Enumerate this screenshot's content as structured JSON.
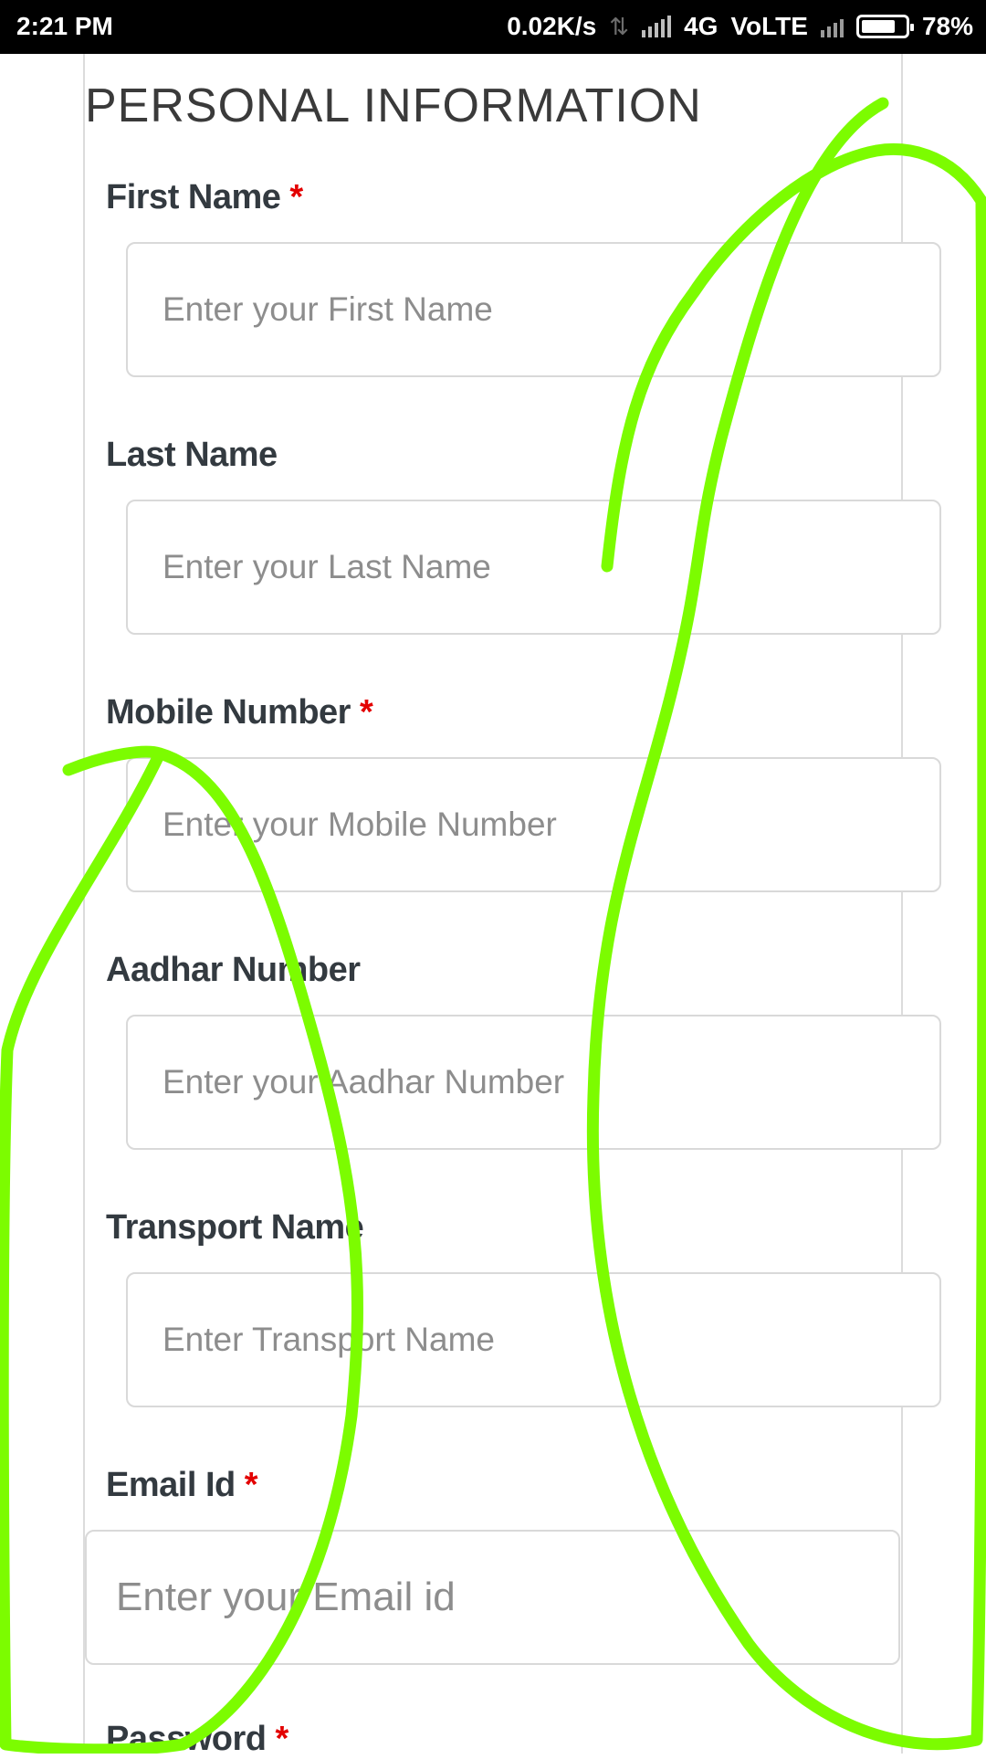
{
  "status_bar": {
    "time": "2:21 PM",
    "net_speed": "0.02K/s",
    "network": "4G",
    "volte": "VoLTE",
    "battery": "78%"
  },
  "form": {
    "section_title": "PERSONAL INFORMATION",
    "required_marker": "*",
    "fields": [
      {
        "label": "First Name",
        "placeholder": "Enter your First Name",
        "required": true
      },
      {
        "label": "Last Name",
        "placeholder": "Enter your Last Name",
        "required": false
      },
      {
        "label": "Mobile Number",
        "placeholder": "Enter your Mobile Number",
        "required": true
      },
      {
        "label": "Aadhar Number",
        "placeholder": "Enter your Aadhar Number",
        "required": false
      },
      {
        "label": "Transport Name",
        "placeholder": "Enter Transport Name",
        "required": false
      },
      {
        "label": "Email Id",
        "placeholder": "Enter your Email id",
        "required": true
      },
      {
        "label": "Password",
        "required": true
      }
    ]
  },
  "annotation": {
    "stroke_color": "#7CFC00"
  }
}
